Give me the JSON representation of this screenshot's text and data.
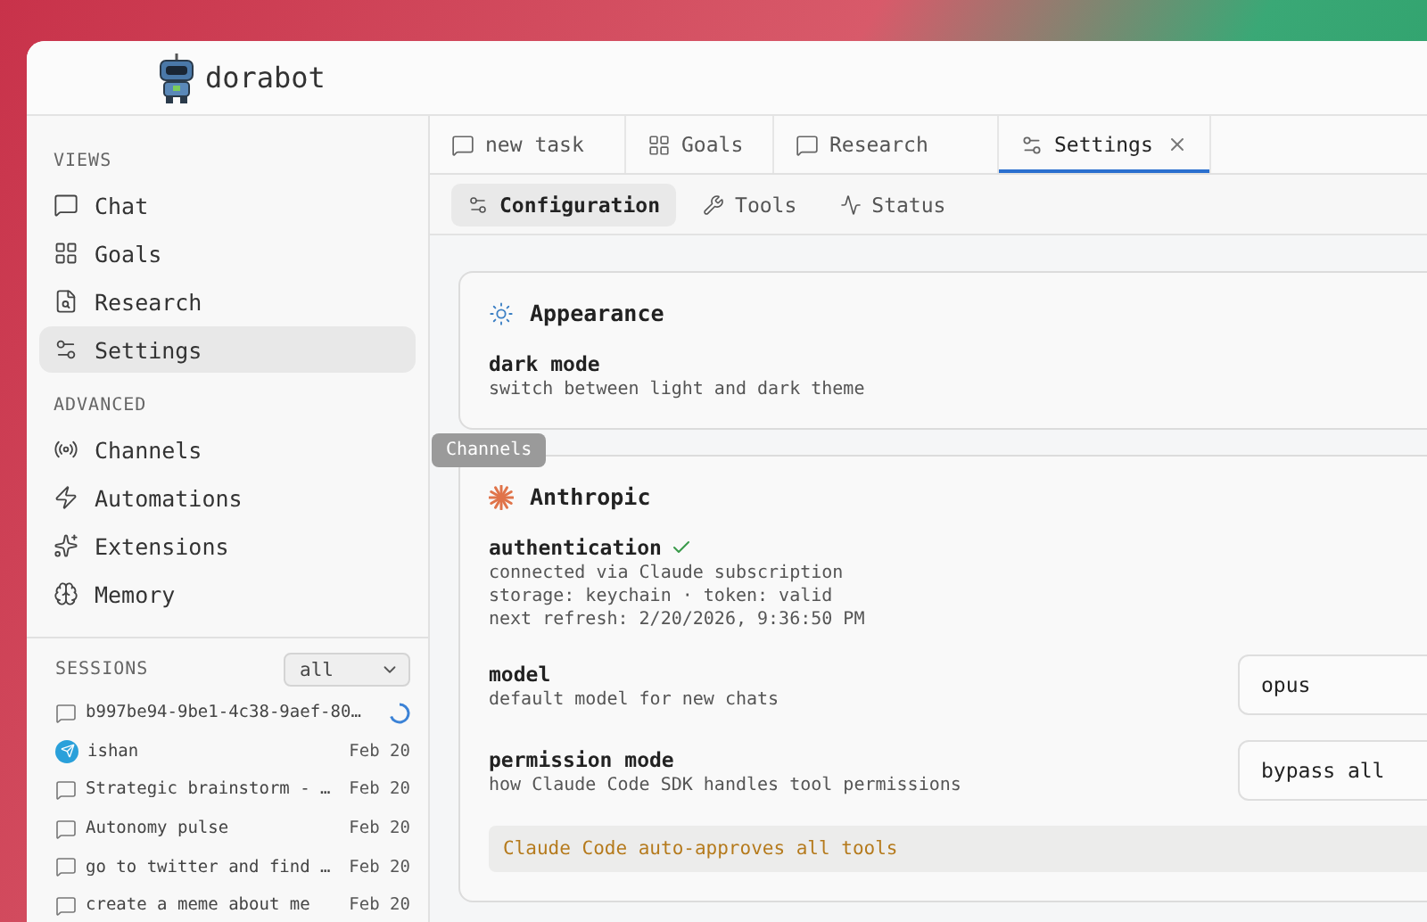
{
  "app": {
    "name": "dorabot"
  },
  "sidebar": {
    "sections": [
      {
        "title": "VIEWS",
        "items": [
          {
            "label": "Chat",
            "selected": false
          },
          {
            "label": "Goals",
            "selected": false
          },
          {
            "label": "Research",
            "selected": false
          },
          {
            "label": "Settings",
            "selected": true
          }
        ]
      },
      {
        "title": "ADVANCED",
        "items": [
          {
            "label": "Channels",
            "selected": false
          },
          {
            "label": "Automations",
            "selected": false
          },
          {
            "label": "Extensions",
            "selected": false
          },
          {
            "label": "Memory",
            "selected": false
          }
        ]
      }
    ],
    "tooltip": "Channels"
  },
  "sessions": {
    "title": "SESSIONS",
    "filter": "all",
    "items": [
      {
        "title": "b997be94-9be1-4c38-9aef-80…",
        "kind": "chat",
        "running": true
      },
      {
        "title": "ishan",
        "kind": "telegram",
        "running": false,
        "date": "Feb 20"
      },
      {
        "title": "Strategic brainstorm - …",
        "kind": "chat",
        "running": false,
        "date": "Feb 20"
      },
      {
        "title": "Autonomy pulse",
        "kind": "chat",
        "running": false,
        "date": "Feb 20"
      },
      {
        "title": "go to twitter and find …",
        "kind": "chat",
        "running": false,
        "date": "Feb 20"
      },
      {
        "title": "create a meme about me",
        "kind": "chat",
        "running": false,
        "date": "Feb 20"
      }
    ]
  },
  "tabs": [
    {
      "label": "new task",
      "selected": false,
      "closable": false
    },
    {
      "label": "Goals",
      "selected": false,
      "closable": false
    },
    {
      "label": "Research",
      "selected": false,
      "closable": false
    },
    {
      "label": "Settings",
      "selected": true,
      "closable": true
    }
  ],
  "subtabs": [
    {
      "label": "Configuration",
      "selected": true
    },
    {
      "label": "Tools",
      "selected": false
    },
    {
      "label": "Status",
      "selected": false
    }
  ],
  "cards": [
    {
      "title": "Appearance",
      "settings": [
        {
          "label": "dark mode",
          "lines": [
            "switch between light and dark theme"
          ]
        }
      ]
    },
    {
      "title": "Anthropic",
      "settings": [
        {
          "label": "authentication",
          "verified": true,
          "lines": [
            "connected via Claude subscription",
            "storage: keychain · token: valid",
            "next refresh: 2/20/2026, 9:36:50 PM"
          ]
        },
        {
          "label": "model",
          "lines": [
            "default model for new chats"
          ],
          "value": "opus"
        },
        {
          "label": "permission mode",
          "lines": [
            "how Claude Code SDK handles tool permissions"
          ],
          "value": "bypass all"
        }
      ],
      "note": "Claude Code auto-approves all tools"
    }
  ]
}
